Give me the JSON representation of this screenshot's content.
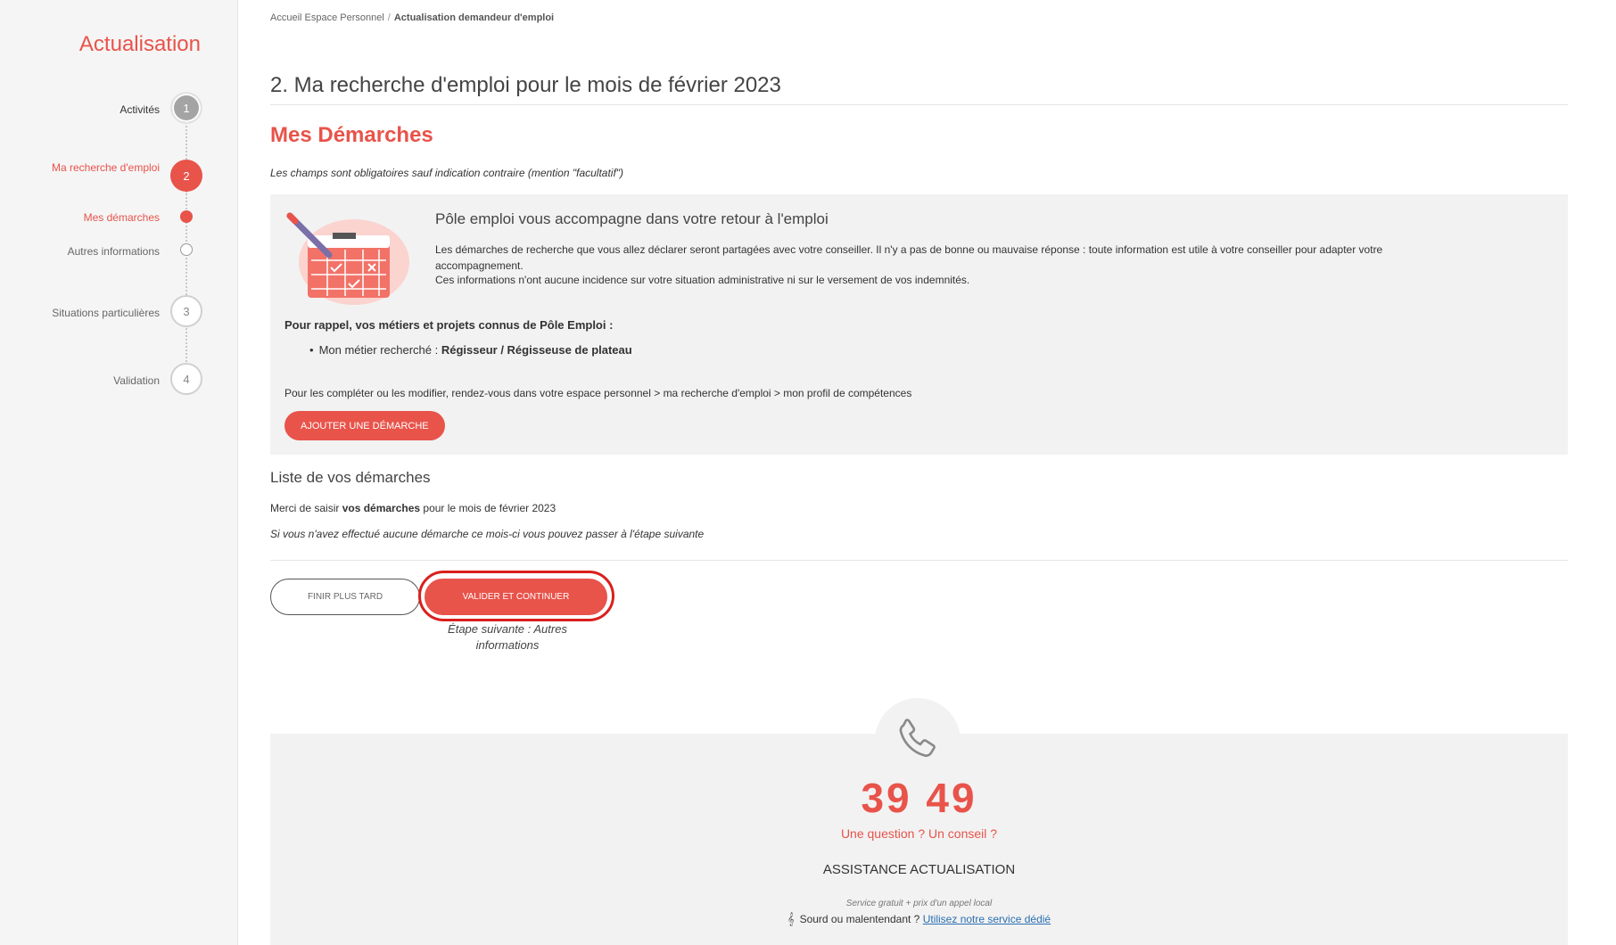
{
  "sidebar": {
    "title": "Actualisation",
    "steps": [
      {
        "label": "Activités",
        "number": "1",
        "state": "done"
      },
      {
        "label": "Ma recherche d'emploi",
        "number": "2",
        "state": "current"
      },
      {
        "label": "Mes démarches",
        "state": "current-sub"
      },
      {
        "label": "Autres informations",
        "state": "todo-sub"
      },
      {
        "label": "Situations particulières",
        "number": "3",
        "state": "todo"
      },
      {
        "label": "Validation",
        "number": "4",
        "state": "todo"
      }
    ]
  },
  "breadcrumb": {
    "home": "Accueil Espace Personnel",
    "separator": "/",
    "current": "Actualisation demandeur d'emploi"
  },
  "page": {
    "title": "2. Ma recherche d'emploi pour le mois de février 2023",
    "section_title": "Mes Démarches",
    "mandatory_note": "Les champs sont obligatoires sauf indication contraire (mention \"facultatif\")"
  },
  "info_box": {
    "heading": "Pôle emploi vous accompagne dans votre retour à l'emploi",
    "p1": "Les démarches de recherche que vous allez déclarer seront partagées avec votre conseiller. Il n'y a pas de bonne ou mauvaise réponse : toute information est utile à votre conseiller pour adapter votre accompagnement.",
    "p2": "Ces informations n'ont aucune incidence sur votre situation administrative ni sur le versement de vos indemnités.",
    "rappel": "Pour rappel, vos métiers et projets connus de Pôle Emploi :",
    "metier_label": "Mon métier recherché : ",
    "metier_value": "Régisseur / Régisseuse de plateau",
    "completer": "Pour les compléter ou les modifier, rendez-vous dans votre espace personnel > ma recherche d'emploi > mon profil de compétences",
    "add_button": "Ajouter une démarche"
  },
  "list": {
    "title": "Liste de vos démarches",
    "intro_prefix": "Merci de saisir ",
    "intro_bold": "vos démarches",
    "intro_suffix": " pour le mois de février 2023",
    "note": "Si vous n'avez effectué aucune démarche ce mois-ci vous pouvez passer à l'étape suivante"
  },
  "actions": {
    "later_button": "Finir plus tard",
    "validate_button": "Valider et continuer",
    "next_step": "Étape suivante : Autres informations"
  },
  "assistance": {
    "phone_number": "39 49",
    "question": "Une question ? Un conseil ?",
    "title": "Assistance actualisation",
    "service_note": "Service gratuit + prix d'un appel local",
    "sourd_text": "Sourd ou malentendant ? ",
    "sourd_link": "Utilisez notre service dédié"
  },
  "colors": {
    "accent": "#e8534a",
    "highlight": "#d9201c",
    "panel": "#f2f2f2"
  }
}
